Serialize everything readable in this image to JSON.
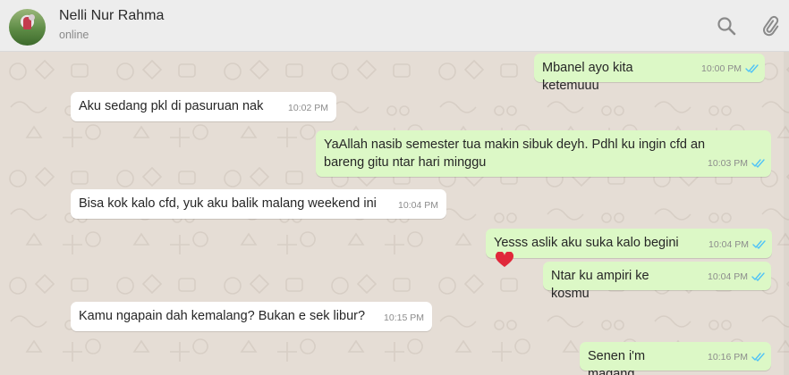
{
  "header": {
    "name": "Nelli Nur Rahma",
    "status": "online",
    "icons": [
      "search-icon",
      "attach-icon"
    ]
  },
  "colors": {
    "chat_bg": "#e5ddd5",
    "incoming": "#ffffff",
    "outgoing": "#dcf8c6",
    "tick_read": "#4fc3f7"
  },
  "messages": [
    {
      "dir": "out",
      "text": "Mbanel ayo kita ketemuuu",
      "time": "10:00 PM",
      "status": "read"
    },
    {
      "dir": "in",
      "text": "Aku sedang pkl di pasuruan nak",
      "time": "10:02 PM"
    },
    {
      "dir": "out",
      "text": "YaAllah nasib semester tua makin sibuk deyh. Pdhl ku ingin cfd an bareng gitu ntar hari minggu",
      "time": "10:03 PM",
      "status": "read"
    },
    {
      "dir": "in",
      "text": "Bisa kok kalo cfd, yuk aku balik malang weekend ini",
      "time": "10:04 PM"
    },
    {
      "dir": "out",
      "text": "Yesss aslik aku suka kalo begini",
      "time": "10:04 PM",
      "status": "read",
      "emoji": "heart-icon"
    },
    {
      "dir": "out",
      "text": "Ntar ku ampiri ke kosmu",
      "time": "10:04 PM",
      "status": "read"
    },
    {
      "dir": "in",
      "text": "Kamu ngapain dah kemalang? Bukan e sek libur?",
      "time": "10:15 PM"
    },
    {
      "dir": "out",
      "text": "Senen i'm magang",
      "time": "10:16 PM",
      "status": "read"
    }
  ]
}
